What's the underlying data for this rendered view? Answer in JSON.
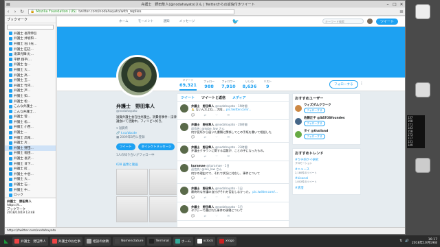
{
  "browser": {
    "title": "弁護士　野田隼人(@nodahayato)さん | Twitterからの返信付きツイート",
    "secure_label": "Mozilla Foundation (US)",
    "url": "twitter.com/nodahayato/with_replies",
    "status": "https://twitter.com/nodahayato"
  },
  "sidebar": {
    "header": "ブックマーク",
    "items": [
      {
        "label": "弁護士 長岡伸吾"
      },
      {
        "label": "弁護士 井坂和..."
      },
      {
        "label": "弁護士 石川光..."
      },
      {
        "label": "弁護士 田辺..."
      },
      {
        "label": "滝澤光輝(た..."
      },
      {
        "label": "平野 翔平(..."
      },
      {
        "label": "弁護士 古..."
      },
      {
        "label": "弁護士 大... "
      },
      {
        "label": "弁護士 高..."
      },
      {
        "label": "弁護士 玉..."
      },
      {
        "label": "弁護士 竹内..."
      },
      {
        "label": "弁護士 戸..."
      },
      {
        "label": "弁護士 知..."
      },
      {
        "label": "弁護士 松..."
      },
      {
        "label": "こんな弁護士 ..."
      },
      {
        "label": "こんな弁護士..."
      },
      {
        "label": "弁護士 菅..."
      },
      {
        "label": "弁護士 松..."
      },
      {
        "label": "弁護士 小西..."
      },
      {
        "label": "弁護士 ..."
      },
      {
        "label": "弁護士 高尾..."
      },
      {
        "label": "弁護士 片..."
      },
      {
        "label": "弁護士 野田..."
      },
      {
        "label": "弁護士 稲田..."
      },
      {
        "label": "弁護士 長沢..."
      },
      {
        "label": "弁護士 日下..."
      },
      {
        "label": "弁護士 町..."
      },
      {
        "label": "弁護士 中谷..."
      },
      {
        "label": "弁護士 大..."
      },
      {
        "label": "弁護士 石..."
      },
      {
        "label": "弁護士 中..."
      },
      {
        "label": "ロック"
      },
      {
        "label": "弁護士 ..."
      }
    ],
    "bottom_title": "弁護士　野田隼人",
    "bottom_lines": [
      "https://t...",
      "ブックマーク",
      "2018/10/19 13:48"
    ]
  },
  "twitter": {
    "nav": [
      "ホーム",
      "モーメント",
      "通知",
      "メッセージ"
    ],
    "search_placeholder": "キーワード検索",
    "tweet_button": "ツイート",
    "stats": [
      {
        "label": "ツイート",
        "value": "69,321"
      },
      {
        "label": "フォロー",
        "value": "988"
      },
      {
        "label": "フォロワー",
        "value": "7,910"
      },
      {
        "label": "いいね",
        "value": "8,636"
      },
      {
        "label": "リスト",
        "value": "9"
      }
    ],
    "follow_button": "フォローする",
    "profile": {
      "name": "弁護士　野田隼人",
      "handle": "@nodahayato",
      "bio": "滋賀弁護士会在住弁護士。消費者事件・法律家協議会にて活動中。フィリピン好き。",
      "location": "滋賀県",
      "link": "t.co/abcde",
      "joined": "2009年8月に登録",
      "btn1": "ツイート",
      "btn2": "ダイレクトメッセージ",
      "followers_info": "1人の知り合いがフォロー中",
      "media": "628 画像と動画"
    },
    "tabs": [
      "ツイート",
      "ツイートと返信",
      "メディア"
    ],
    "tweets": [
      {
        "name": "弁護士　野田隼人",
        "handle": "@nodahayato · 19時間",
        "reply": "",
        "text": "🙏 ないんだよね… 大阪... ",
        "link": "pic.twitter.com/..."
      },
      {
        "name": "弁護士　野田隼人",
        "handle": "@nodahayato · 20時間",
        "reply": "返信先: @kobe_law さん",
        "text": "何か役所から届いた書類に関係してこの手紙を書いて相談した",
        "link": ""
      },
      {
        "name": "弁護士　野田隼人",
        "handle": "@nodahayato · 23時間",
        "reply": "",
        "text": "弁護士クラウンに関する話題が、ことの子になったもの。",
        "link": ""
      },
      {
        "name": "kuramae",
        "handle": "@kuramae · 1日",
        "reply": "返信先: @loo_law さん",
        "text": "何かの理由でで、それで状況に対応し、事件について",
        "link": ""
      },
      {
        "name": "弁護士　野田隼人",
        "handle": "@nodahayato · 1日",
        "reply": "",
        "text": "最終的な弁護の自分がそれを否定しなかった。",
        "link": "pic.twitter.com/..."
      },
      {
        "name": "弁護士　野田隼人",
        "handle": "@nodahayato · 1日",
        "reply": "",
        "text": "タクシーで運ばれた事件の現場について",
        "link": ""
      }
    ],
    "recommend": {
      "title": "おすすめユーザー",
      "users": [
        {
          "name": "ウィズダムクラーク",
          "btn": "フォローする"
        },
        {
          "name": "佐藤正子 @SATOSfoundes",
          "btn": "フォローする"
        },
        {
          "name": "タイ @thailand",
          "btn": "フォローする"
        }
      ]
    },
    "trends": {
      "title": "おすすめトレンド",
      "items": [
        {
          "tag": "#ウチ的ケイ研究",
          "desc": "プロモーション"
        },
        {
          "tag": "#ニュース",
          "desc": "2,180件のツイート"
        },
        {
          "tag": "#kisonal",
          "desc": "1,802件のツイート"
        },
        {
          "tag": "#清澄"
        }
      ]
    }
  },
  "terminal": [
    "137",
    "198",
    "171",
    "143",
    "158",
    "173",
    "117",
    "131",
    "149"
  ],
  "taskbar": {
    "items": [
      {
        "label": "弁護士　野田隼人",
        "color": "#e44"
      },
      {
        "label": "弁護士のお仕事",
        "color": "#e44"
      },
      {
        "label": "相談の依頼",
        "color": "#aaa"
      },
      {
        "label": "Nomenclature",
        "color": "#444"
      },
      {
        "label": "Terminal",
        "color": "#222"
      },
      {
        "label": "ホーム",
        "color": "#3a9"
      },
      {
        "label": "xclock",
        "color": "#fff"
      },
      {
        "label": "xlogo",
        "color": "#c22"
      }
    ],
    "time": "16:17",
    "date": "2018年10月19日"
  }
}
